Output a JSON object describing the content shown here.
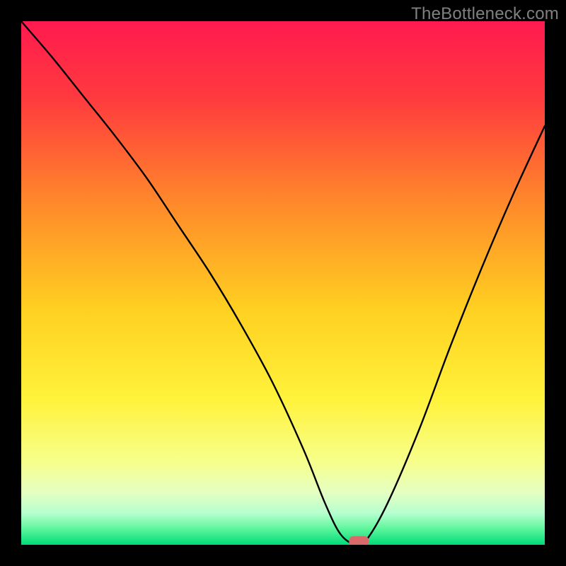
{
  "watermark": "TheBottleneck.com",
  "chart_data": {
    "type": "line",
    "title": "",
    "xlabel": "",
    "ylabel": "",
    "xlim": [
      0,
      100
    ],
    "ylim": [
      0,
      100
    ],
    "series": [
      {
        "name": "bottleneck-curve",
        "x": [
          0,
          6,
          12,
          18,
          24,
          30,
          36,
          42,
          48,
          54,
          58,
          61,
          64,
          66,
          70,
          76,
          82,
          88,
          94,
          100
        ],
        "y": [
          100,
          93,
          85.5,
          78,
          70,
          61,
          52,
          42,
          31,
          18,
          8,
          2,
          0,
          1,
          8,
          22,
          38,
          53,
          67,
          80
        ]
      }
    ],
    "marker": {
      "x": 64.5,
      "y": 0.7
    },
    "background_gradient": {
      "stops": [
        {
          "offset": 0.0,
          "color": "#ff1a4f"
        },
        {
          "offset": 0.15,
          "color": "#ff3b3e"
        },
        {
          "offset": 0.35,
          "color": "#ff8a2a"
        },
        {
          "offset": 0.55,
          "color": "#ffd021"
        },
        {
          "offset": 0.72,
          "color": "#fff23a"
        },
        {
          "offset": 0.84,
          "color": "#f7ff8a"
        },
        {
          "offset": 0.9,
          "color": "#e5ffc2"
        },
        {
          "offset": 0.94,
          "color": "#b6ffcf"
        },
        {
          "offset": 0.97,
          "color": "#5cf59b"
        },
        {
          "offset": 1.0,
          "color": "#00db79"
        }
      ]
    },
    "marker_color": "#d86a6a"
  }
}
